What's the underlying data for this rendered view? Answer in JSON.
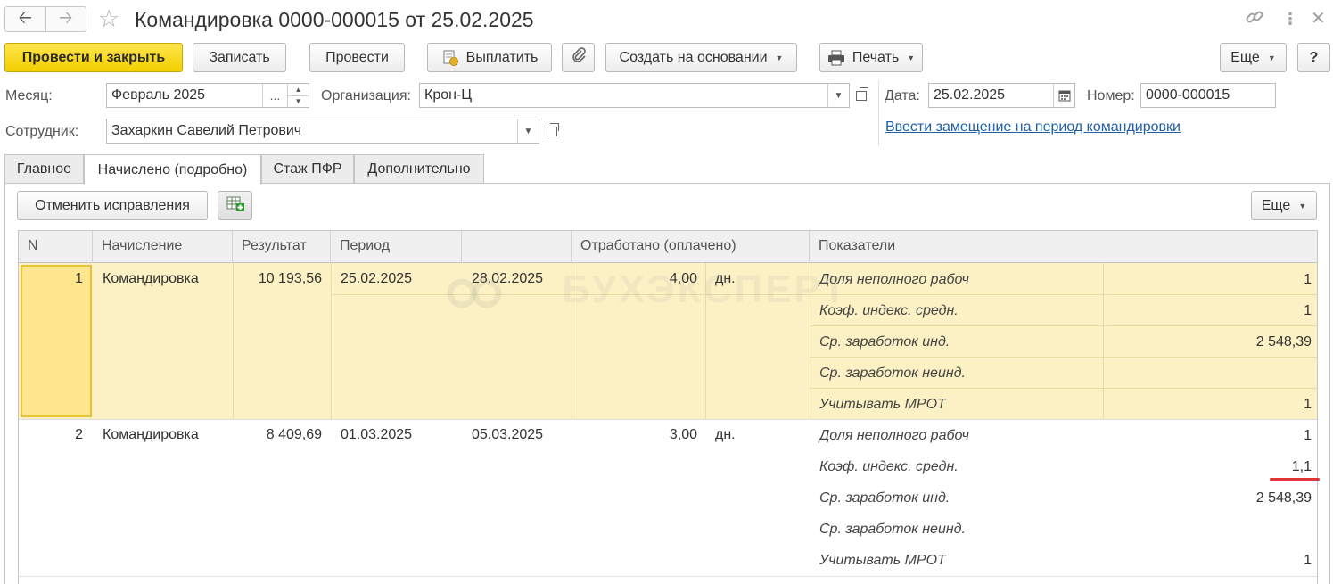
{
  "window": {
    "title": "Командировка 0000-000015 от 25.02.2025"
  },
  "toolbar": {
    "post_close": "Провести и закрыть",
    "save": "Записать",
    "post": "Провести",
    "pay": "Выплатить",
    "create_based": "Создать на основании",
    "print": "Печать",
    "more": "Еще",
    "help": "?"
  },
  "form": {
    "month_label": "Месяц:",
    "month_value": "Февраль 2025",
    "month_more": "...",
    "org_label": "Организация:",
    "org_value": "Крон-Ц",
    "date_label": "Дата:",
    "date_value": "25.02.2025",
    "number_label": "Номер:",
    "number_value": "0000-000015",
    "employee_label": "Сотрудник:",
    "employee_value": "Захаркин Савелий Петрович",
    "substitute_link": "Ввести замещение на период командировки"
  },
  "tabs": [
    {
      "label": "Главное"
    },
    {
      "label": "Начислено (подробно)"
    },
    {
      "label": "Стаж ПФР"
    },
    {
      "label": "Дополнительно"
    }
  ],
  "panel": {
    "cancel_corrections": "Отменить исправления",
    "more": "Еще"
  },
  "grid": {
    "headers": {
      "n": "N",
      "accrual": "Начисление",
      "result": "Результат",
      "period": "Период",
      "period_end": "",
      "worked": "Отработано (оплачено)",
      "indicators": "Показатели"
    },
    "rows": [
      {
        "n": "1",
        "accrual": "Командировка",
        "result": "10 193,56",
        "date_from": "25.02.2025",
        "date_to": "28.02.2025",
        "worked": "4,00",
        "unit": "дн.",
        "indicators": [
          {
            "name": "Доля неполного рабоч",
            "value": "1"
          },
          {
            "name": "Коэф. индекс. средн.",
            "value": "1"
          },
          {
            "name": "Ср. заработок инд.",
            "value": "2 548,39"
          },
          {
            "name": "Ср. заработок неинд.",
            "value": ""
          },
          {
            "name": "Учитывать МРОТ",
            "value": "1"
          }
        ]
      },
      {
        "n": "2",
        "accrual": "Командировка",
        "result": "8 409,69",
        "date_from": "01.03.2025",
        "date_to": "05.03.2025",
        "worked": "3,00",
        "unit": "дн.",
        "indicators": [
          {
            "name": "Доля неполного рабоч",
            "value": "1"
          },
          {
            "name": "Коэф. индекс. средн.",
            "value": "1,1"
          },
          {
            "name": "Ср. заработок инд.",
            "value": "2 548,39"
          },
          {
            "name": "Ср. заработок неинд.",
            "value": ""
          },
          {
            "name": "Учитывать МРОТ",
            "value": "1"
          }
        ]
      }
    ]
  },
  "watermark": "БУХЭКСПЕРТ",
  "colors": {
    "primary_button": "#f3cf00",
    "selected_row": "#fcf1c4",
    "link": "#1f5ea8",
    "underline_mark": "#e23535"
  }
}
